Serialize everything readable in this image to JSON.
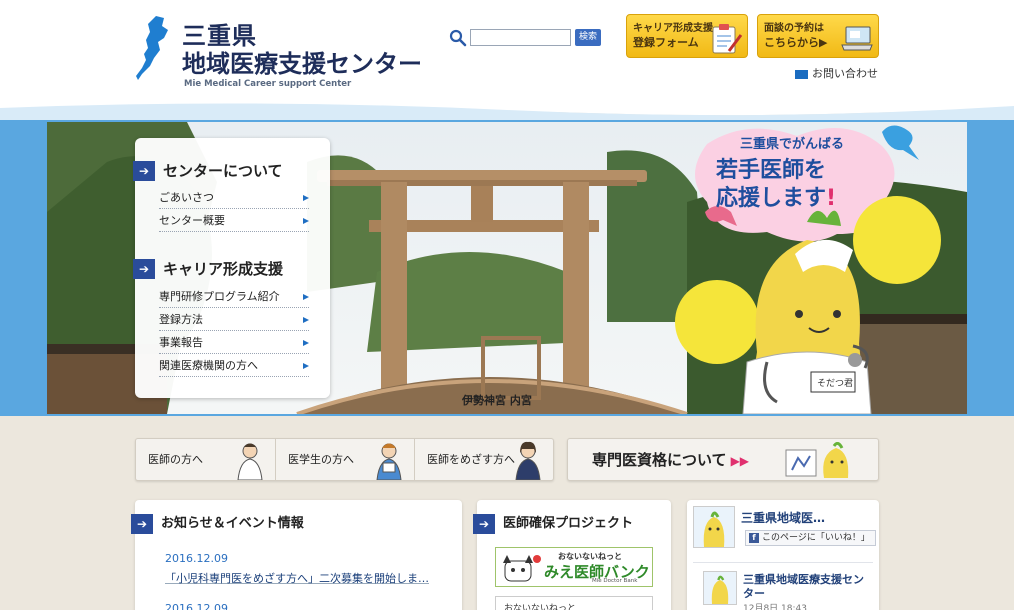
{
  "header": {
    "logo_line1": "三重県",
    "logo_line2": "地域医療支援センター",
    "logo_sub": "Mie Medical Career support Center",
    "search": {
      "placeholder": "",
      "button_label": "検索"
    },
    "career_form": {
      "line1": "キャリア形成支援",
      "line2": "登録フォーム"
    },
    "interview": {
      "line1": "面談の予約は",
      "line2": "こちらから▶"
    },
    "contact_label": "お問い合わせ"
  },
  "side_menu": {
    "sections": [
      {
        "heading": "センターについて",
        "items": [
          "ごあいさつ",
          "センター概要"
        ]
      },
      {
        "heading": "キャリア形成支援",
        "items": [
          "専門研修プログラム紹介",
          "登録方法",
          "事業報告",
          "関連医療機関の方へ"
        ]
      }
    ]
  },
  "hero": {
    "caption": "伊勢神宮 内宮",
    "cheer_line1": "三重県でがんばる",
    "cheer_line2": "若手医師を",
    "cheer_line3": "応援します",
    "mascot_badge": "そだつ君"
  },
  "audience_nav": [
    "医師の方へ",
    "医学生の方へ",
    "医師をめざす方へ"
  ],
  "specialist": {
    "label": "専門医資格について",
    "arrows": "▶▶"
  },
  "news": {
    "heading": "お知らせ＆イベント情報",
    "items": [
      {
        "date": "2016.12.09",
        "title": "「小児科専門医をめざす方へ」二次募集を開始しま…"
      },
      {
        "date": "2016.12.09",
        "title": ""
      }
    ]
  },
  "project": {
    "heading": "医師確保プロジェクト",
    "bank_top": "おないないねっと",
    "bank_main": "みえ医師バンク",
    "bank_en": "Mie Doctor Bank",
    "bank2_text": "おないないねっと"
  },
  "facebook": {
    "page_name": "三重県地域医…",
    "like_label": "このページに「いいね！」",
    "post_name": "三重県地域医療支援センター",
    "post_time": "12月8日 18:43"
  },
  "colors": {
    "navy": "#1e2d5a",
    "accent_blue": "#2a4c9b",
    "hero_band": "#5aa7e0",
    "button_yellow": "#f1b915",
    "beige_bg": "#ece7dd"
  }
}
